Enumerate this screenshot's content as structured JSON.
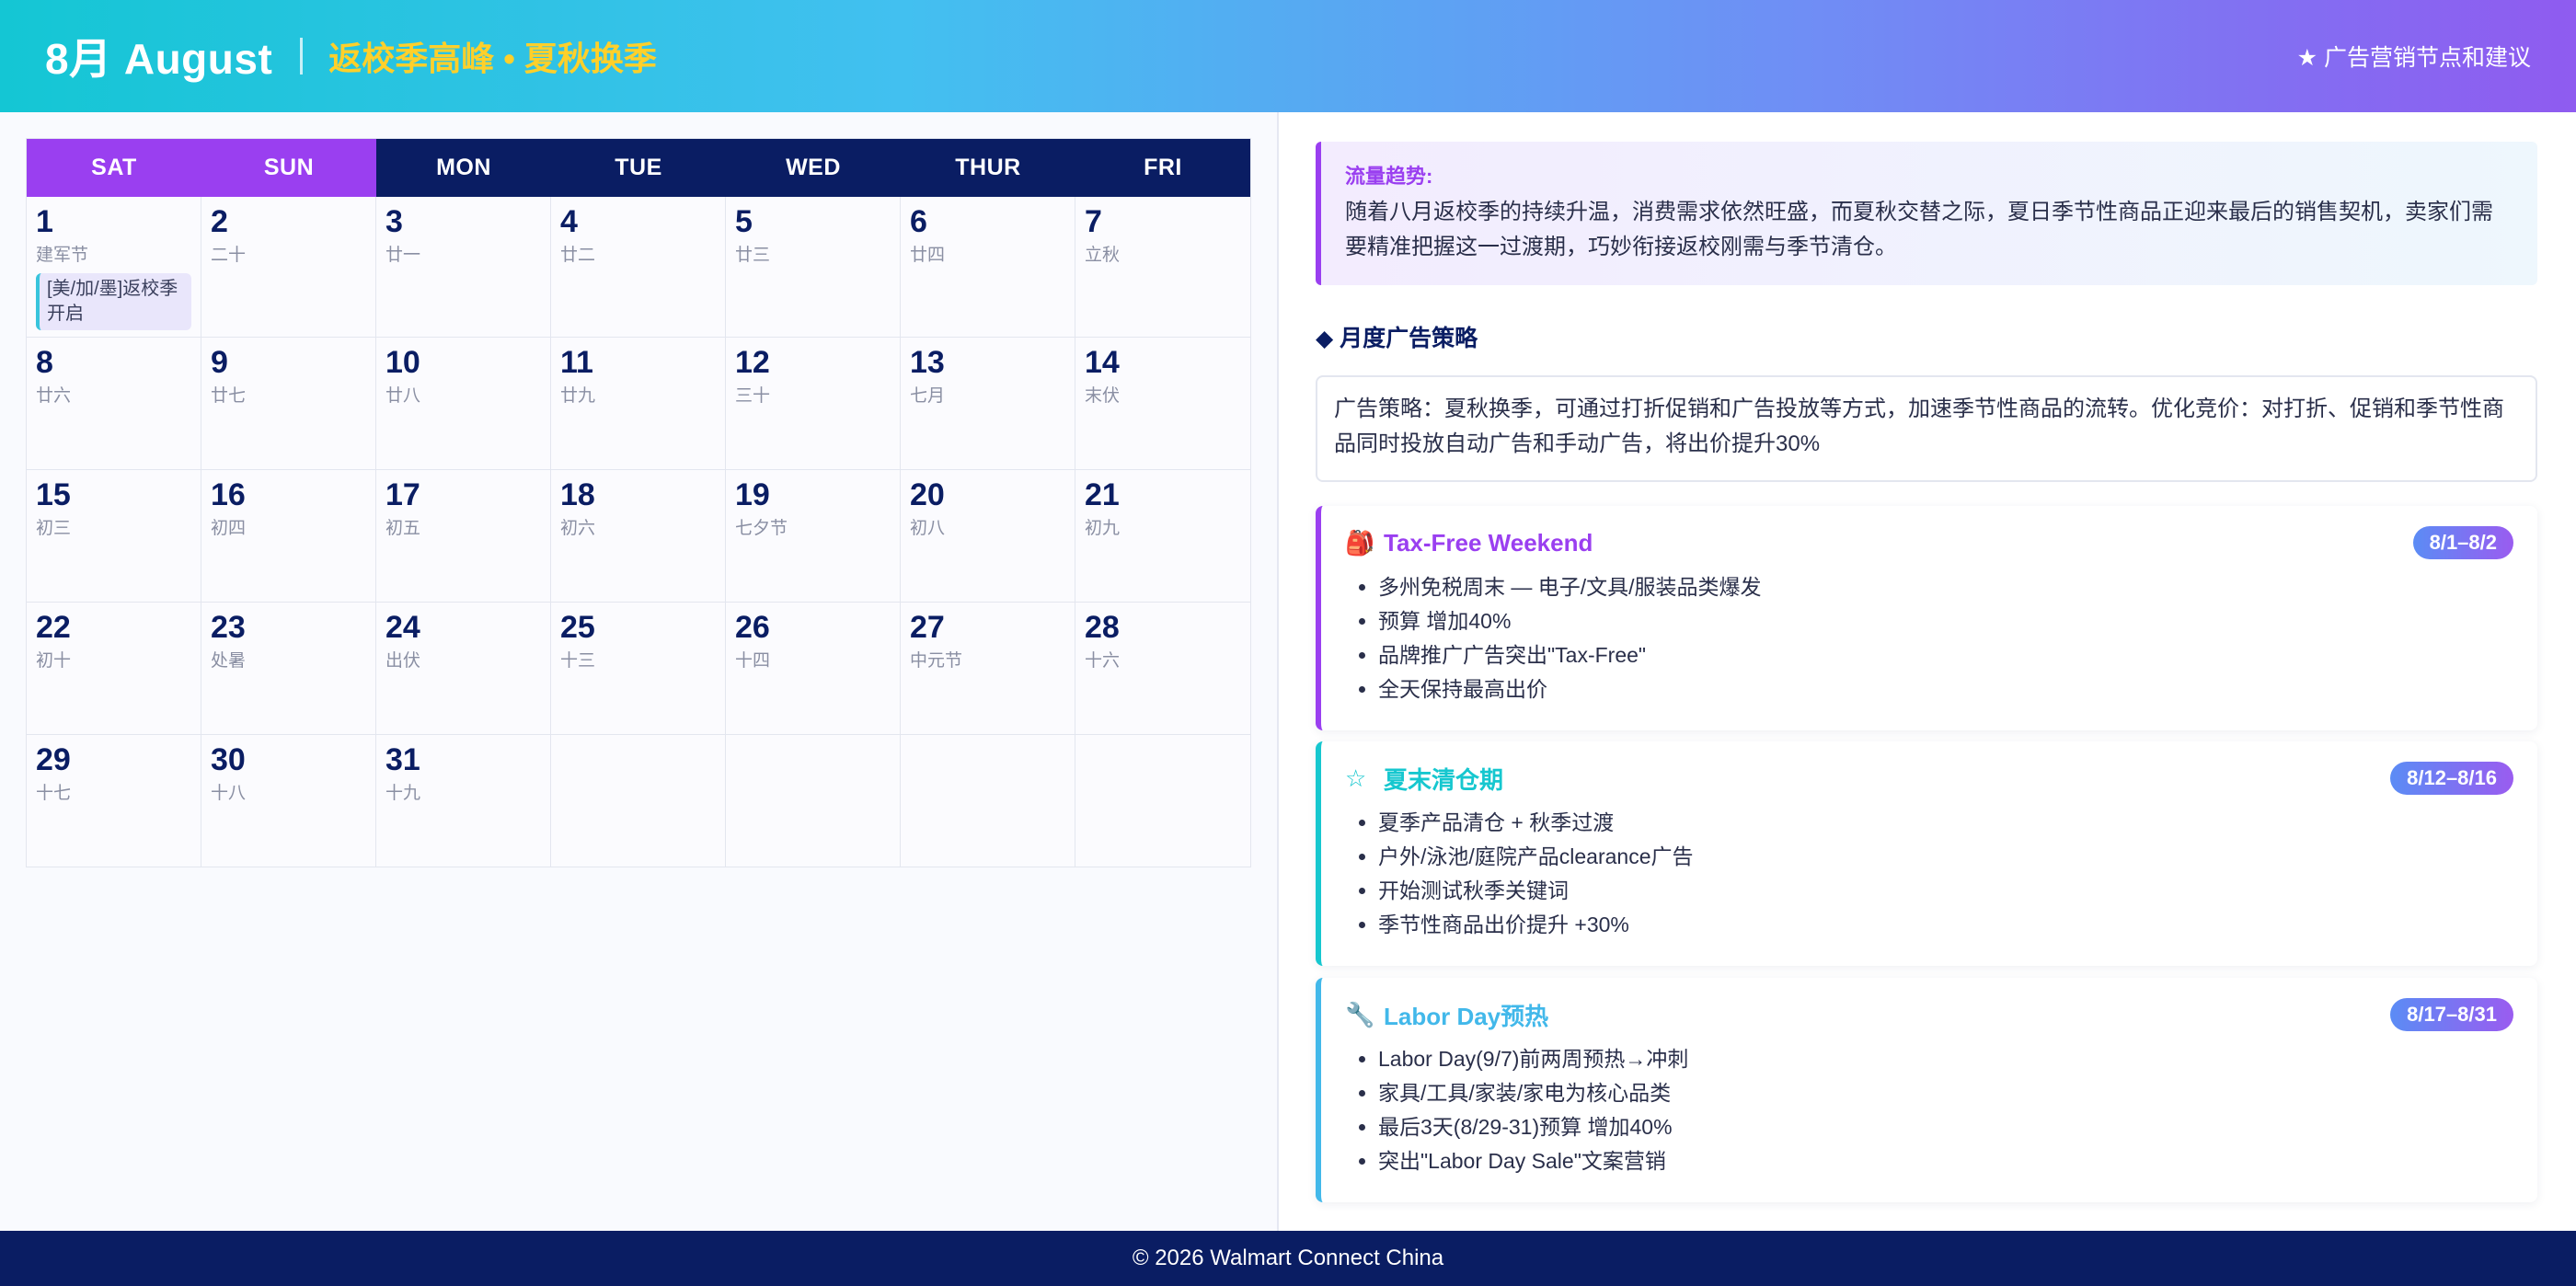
{
  "header": {
    "title": "8月 August",
    "subtitle": "返校季高峰 • 夏秋换季",
    "right_label": "★ 广告营销节点和建议"
  },
  "calendar": {
    "weekdays": [
      "SAT",
      "SUN",
      "MON",
      "TUE",
      "WED",
      "THUR",
      "FRI"
    ],
    "weeks": [
      [
        {
          "day": "1",
          "lunar": "建军节",
          "event": "[美/加/墨]返校季开启"
        },
        {
          "day": "2",
          "lunar": "二十"
        },
        {
          "day": "3",
          "lunar": "廿一"
        },
        {
          "day": "4",
          "lunar": "廿二"
        },
        {
          "day": "5",
          "lunar": "廿三"
        },
        {
          "day": "6",
          "lunar": "廿四"
        },
        {
          "day": "7",
          "lunar": "立秋"
        }
      ],
      [
        {
          "day": "8",
          "lunar": "廿六"
        },
        {
          "day": "9",
          "lunar": "廿七"
        },
        {
          "day": "10",
          "lunar": "廿八"
        },
        {
          "day": "11",
          "lunar": "廿九"
        },
        {
          "day": "12",
          "lunar": "三十"
        },
        {
          "day": "13",
          "lunar": "七月"
        },
        {
          "day": "14",
          "lunar": "末伏"
        }
      ],
      [
        {
          "day": "15",
          "lunar": "初三"
        },
        {
          "day": "16",
          "lunar": "初四"
        },
        {
          "day": "17",
          "lunar": "初五"
        },
        {
          "day": "18",
          "lunar": "初六"
        },
        {
          "day": "19",
          "lunar": "七夕节"
        },
        {
          "day": "20",
          "lunar": "初八"
        },
        {
          "day": "21",
          "lunar": "初九"
        }
      ],
      [
        {
          "day": "22",
          "lunar": "初十"
        },
        {
          "day": "23",
          "lunar": "处暑"
        },
        {
          "day": "24",
          "lunar": "出伏"
        },
        {
          "day": "25",
          "lunar": "十三"
        },
        {
          "day": "26",
          "lunar": "十四"
        },
        {
          "day": "27",
          "lunar": "中元节"
        },
        {
          "day": "28",
          "lunar": "十六"
        }
      ],
      [
        {
          "day": "29",
          "lunar": "十七"
        },
        {
          "day": "30",
          "lunar": "十八"
        },
        {
          "day": "31",
          "lunar": "十九"
        },
        {},
        {},
        {},
        {}
      ]
    ]
  },
  "trend": {
    "label": "流量趋势:",
    "text": "随着八月返校季的持续升温，消费需求依然旺盛，而夏秋交替之际，夏日季节性商品正迎来最后的销售契机，卖家们需要精准把握这一过渡期，巧妙衔接返校刚需与季节清仓。"
  },
  "strategy": {
    "title": "◆ 月度广告策略",
    "text": "广告策略：夏秋换季，可通过打折促销和广告投放等方式，加速季节性商品的流转。优化竞价：对打折、促销和季节性商品同时投放自动广告和手动广告，将出价提升30%"
  },
  "cards": [
    {
      "icon": "🎒",
      "icon_name": "backpack-icon",
      "title": "Tax-Free Weekend",
      "badge": "8/1–8/2",
      "color": "#9a3ff0",
      "title_color": "#9a3ff0",
      "badge_bg": "linear-gradient(90deg,#5b8cf5,#9a5cf0)",
      "items": [
        "多州免税周末 — 电子/文具/服装品类爆发",
        "预算 增加40%",
        "品牌推广广告突出\"Tax-Free\"",
        "全天保持最高出价"
      ]
    },
    {
      "icon": "☆",
      "icon_name": "star-icon",
      "title": "夏末清仓期",
      "badge": "8/12–8/16",
      "color": "#16c7cf",
      "title_color": "#16c7cf",
      "badge_bg": "linear-gradient(90deg,#5b8cf5,#9a5cf0)",
      "items": [
        "夏季产品清仓 + 秋季过渡",
        "户外/泳池/庭院产品clearance广告",
        "开始测试秋季关键词",
        "季节性商品出价提升 +30%"
      ]
    },
    {
      "icon": "🔧",
      "icon_name": "wrench-icon",
      "title": "Labor Day预热",
      "badge": "8/17–8/31",
      "color": "#42b8ea",
      "title_color": "#42b8ea",
      "badge_bg": "linear-gradient(90deg,#5b8cf5,#9a5cf0)",
      "items": [
        "Labor Day(9/7)前两周预热→冲刺",
        "家具/工具/家装/家电为核心品类",
        "最后3天(8/29-31)预算 增加40%",
        "突出\"Labor Day Sale\"文案营销"
      ]
    }
  ],
  "footer": {
    "text": "© 2026 Walmart Connect China"
  }
}
